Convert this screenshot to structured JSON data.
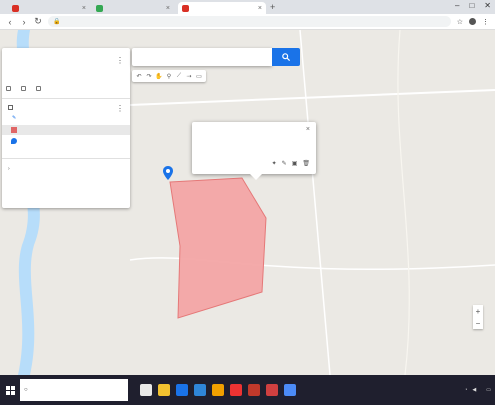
{
  "browser": {
    "tabs": [
      {
        "label": "",
        "active": false,
        "favicon_color": "#d93025"
      },
      {
        "label": "",
        "active": false,
        "favicon_color": "#34a853"
      },
      {
        "label": "",
        "active": true,
        "favicon_color": "#d93025"
      }
    ],
    "new_tab_icon": "plus-icon",
    "url": "",
    "window_controls": [
      "minimize-icon",
      "maximize-icon",
      "close-icon"
    ]
  },
  "left_panel": {
    "title": "",
    "subtitle": "",
    "description": "",
    "actions": [
      {
        "label": "",
        "icon": "add-layer-icon"
      },
      {
        "label": "",
        "icon": "share-icon"
      },
      {
        "label": "",
        "icon": "preview-icon"
      }
    ],
    "layer": {
      "title": "",
      "style_label": "",
      "features": [
        {
          "label": "",
          "icon": "polygon-icon",
          "color": "#e06666"
        },
        {
          "label": "",
          "icon": "pin-icon",
          "color": "#1a73e8"
        }
      ]
    },
    "base_map_label": ""
  },
  "search": {
    "value": "",
    "button_icon": "search-icon"
  },
  "toolbar": {
    "tools": [
      "undo-icon",
      "redo-icon",
      "hand-icon",
      "pin-icon",
      "line-icon",
      "route-icon",
      "ruler-icon"
    ]
  },
  "info_card": {
    "title": "",
    "description": "",
    "measurement": "",
    "actions": [
      "style-icon",
      "edit-icon",
      "photo-icon",
      "delete-icon"
    ]
  },
  "map": {
    "polygon_color": "#f4a6a6",
    "polygon_stroke": "#e57373",
    "marker_color": "#1a73e8",
    "place_labels": [],
    "village_labels": []
  },
  "branding": {
    "google": "",
    "my_maps": ""
  },
  "taskbar": {
    "search_placeholder": "",
    "apps": [
      "#e8e8e8",
      "#f2c230",
      "#1a73e8",
      "#2f86d8",
      "#f0a000",
      "#e33",
      "#c0392b",
      "#d04040",
      "#4c8bf5"
    ],
    "clock_time": "",
    "clock_date": ""
  }
}
